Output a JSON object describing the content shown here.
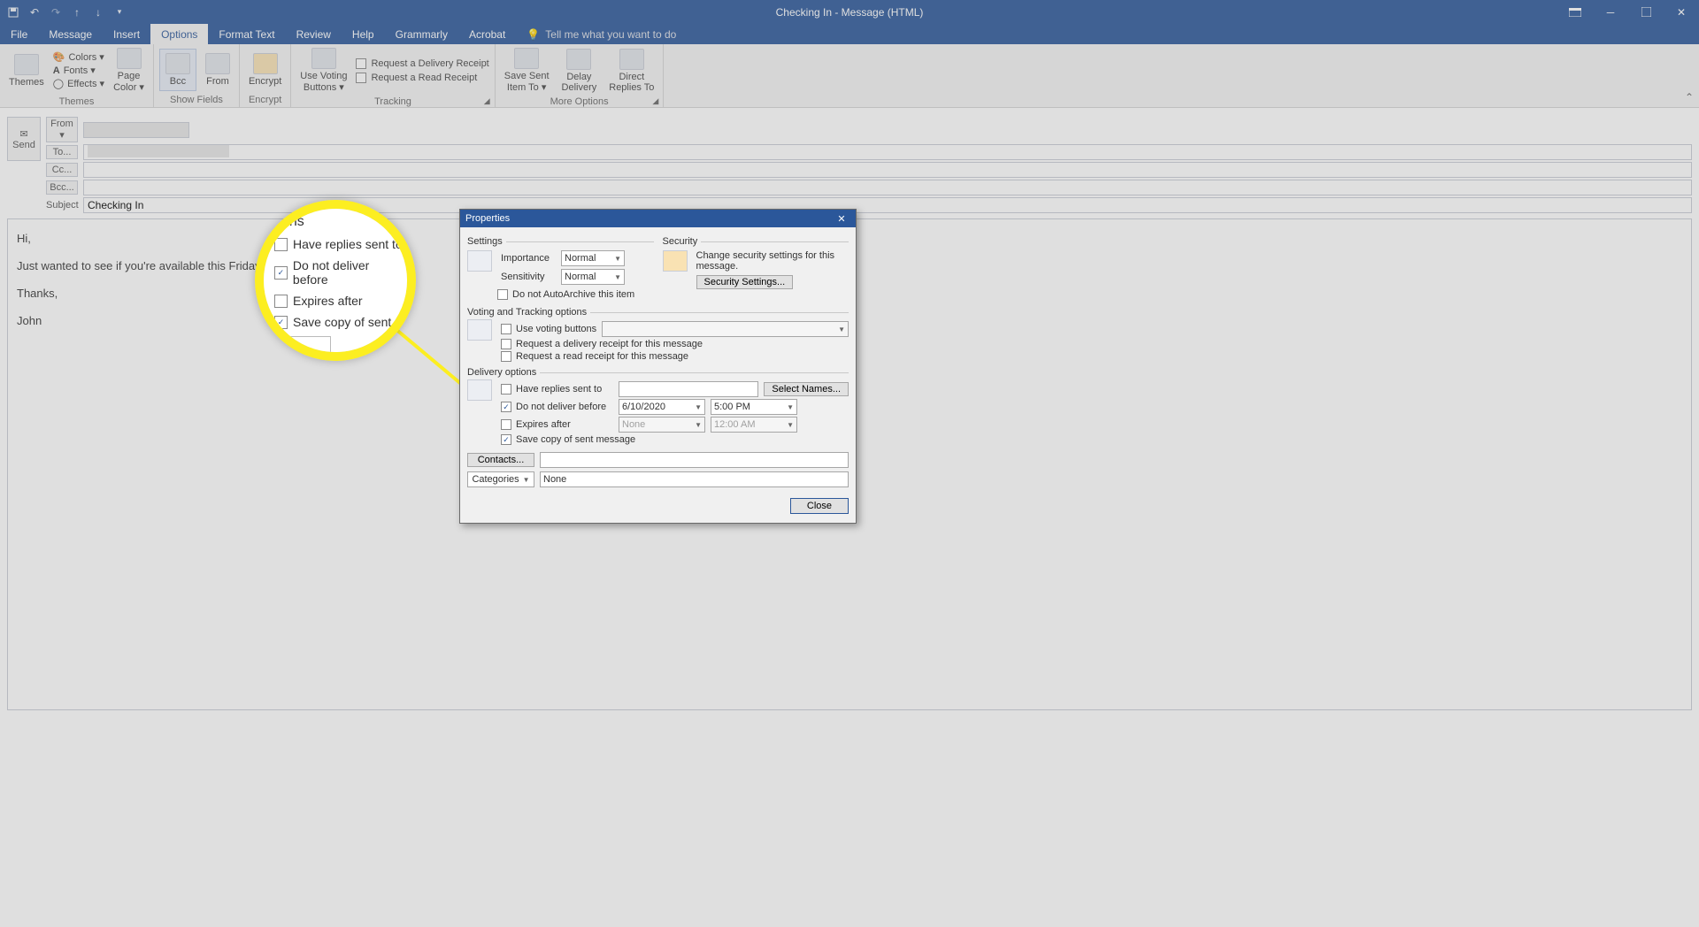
{
  "window": {
    "title": "Checking In  -  Message (HTML)"
  },
  "tabs": {
    "file": "File",
    "message": "Message",
    "insert": "Insert",
    "options": "Options",
    "format": "Format Text",
    "review": "Review",
    "help": "Help",
    "grammarly": "Grammarly",
    "acrobat": "Acrobat",
    "tell": "Tell me what you want to do"
  },
  "ribbon": {
    "themes": {
      "themes": "Themes",
      "colors": "Colors ▾",
      "fonts": "Fonts ▾",
      "effects": "Effects ▾",
      "page_color": "Page\nColor ▾",
      "group": "Themes"
    },
    "show_fields": {
      "bcc": "Bcc",
      "from": "From",
      "group": "Show Fields"
    },
    "encrypt": {
      "encrypt": "Encrypt",
      "group": "Encrypt"
    },
    "tracking": {
      "voting": "Use Voting\nButtons ▾",
      "req_delivery": "Request a Delivery Receipt",
      "req_read": "Request a Read Receipt",
      "group": "Tracking"
    },
    "more": {
      "save_sent": "Save Sent\nItem To ▾",
      "delay": "Delay\nDelivery",
      "direct": "Direct\nReplies To",
      "group": "More Options"
    }
  },
  "compose": {
    "send": "Send",
    "from_btn": "From ▾",
    "to": "To...",
    "cc": "Cc...",
    "bcc": "Bcc...",
    "subject_lbl": "Subject",
    "subject_val": "Checking In",
    "line1": "Hi,",
    "line2": "Just wanted to see if you're available this Friday.",
    "line3": "Thanks,",
    "line4": "John"
  },
  "magnifier": {
    "hdr": "tions",
    "r1": "Have replies sent to",
    "r2": "Do not deliver before",
    "r3": "Expires after",
    "r4": "Save copy of sent m"
  },
  "dlg": {
    "title": "Properties",
    "settings": "Settings",
    "security": "Security",
    "importance": "Importance",
    "importance_val": "Normal",
    "sensitivity": "Sensitivity",
    "sensitivity_val": "Normal",
    "autoarchive": "Do not AutoArchive this item",
    "sec_text": "Change security settings for this message.",
    "sec_btn": "Security Settings...",
    "vt_hdr": "Voting and Tracking options",
    "use_voting": "Use voting buttons",
    "req_del": "Request a delivery receipt for this message",
    "req_read": "Request a read receipt for this message",
    "del_hdr": "Delivery options",
    "have_replies": "Have replies sent to",
    "select_names": "Select Names...",
    "not_before": "Do not deliver before",
    "date": "6/10/2020",
    "time": "5:00 PM",
    "expires": "Expires after",
    "exp_date": "None",
    "exp_time": "12:00 AM",
    "save_copy": "Save copy of sent message",
    "contacts": "Contacts...",
    "categories": "Categories",
    "categories_val": "None",
    "close": "Close"
  }
}
